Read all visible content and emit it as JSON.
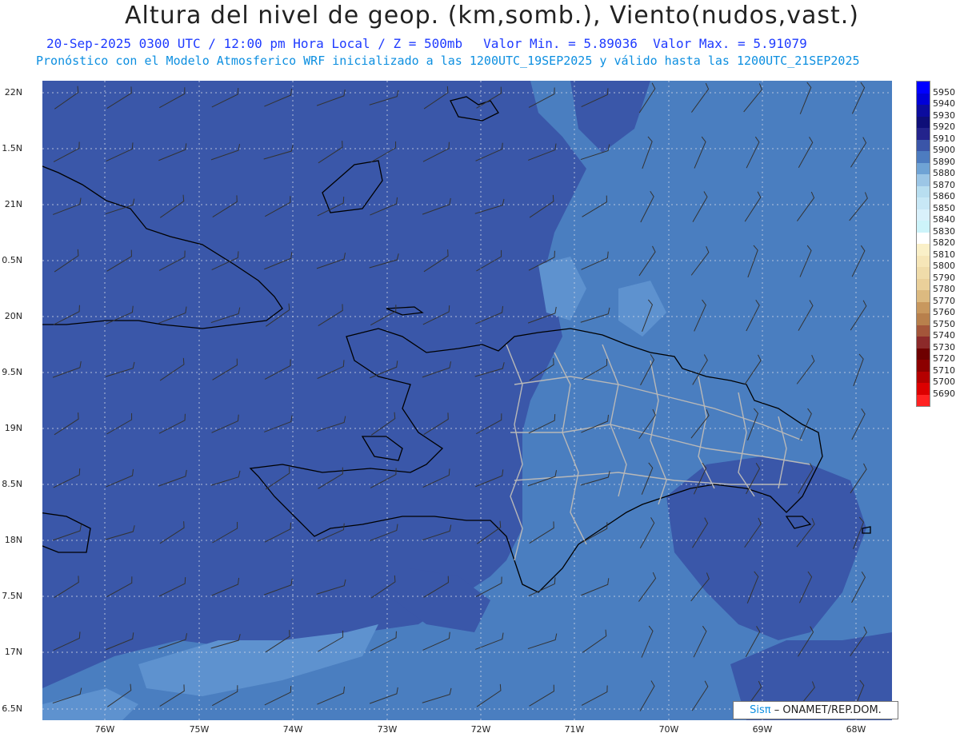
{
  "title": "Altura del nivel de geop. (km,somb.), Viento(nudos,vast.)",
  "subtitle": {
    "valid": "20-Sep-2025  0300 UTC / 12:00 pm Hora Local / Z = 500mb",
    "min": "Valor Min. = 5.89036",
    "max": "Valor Max. = 5.91079"
  },
  "model_note": "Pronóstico con el Modelo Atmosferico WRF inicializado a las 1200UTC_19SEP2025 y válido hasta las  1200UTC_21SEP2025",
  "lat_labels": [
    "22N",
    "1.5N",
    "21N",
    "0.5N",
    "20N",
    "9.5N",
    "19N",
    "8.5N",
    "18N",
    "7.5N",
    "17N",
    "6.5N"
  ],
  "lon_labels": [
    "76W",
    "75W",
    "74W",
    "73W",
    "72W",
    "71W",
    "70W",
    "69W",
    "68W"
  ],
  "colorbar": {
    "labels": [
      "5950",
      "5940",
      "5930",
      "5920",
      "5910",
      "5900",
      "5890",
      "5880",
      "5870",
      "5860",
      "5850",
      "5840",
      "5830",
      "5820",
      "5810",
      "5800",
      "5790",
      "5780",
      "5770",
      "5760",
      "5750",
      "5740",
      "5730",
      "5720",
      "5710",
      "5700",
      "5690"
    ],
    "colors": [
      "#0000ff",
      "#0000d8",
      "#0c0c9e",
      "#0e0e78",
      "#23238c",
      "#3a55a8",
      "#4d7cc0",
      "#6fa3d5",
      "#9cc6e6",
      "#b8def0",
      "#c8e8f6",
      "#d9f1fb",
      "#cdf4fa",
      "#ffffff",
      "#faf0c8",
      "#f6e6b8",
      "#f0dcaa",
      "#ead09a",
      "#dcba80",
      "#c8985e",
      "#b8804c",
      "#a4563a",
      "#8c2a2a",
      "#6e0000",
      "#8c0000",
      "#b40000",
      "#dc0000",
      "#ff2222"
    ]
  },
  "map_colors": {
    "dark": "#3a57a9",
    "mid": "#4a7ec0",
    "light": "#5e92cf"
  },
  "credit": {
    "brand": "Sisπ",
    "text": "– ONAMET/REP.DOM."
  }
}
